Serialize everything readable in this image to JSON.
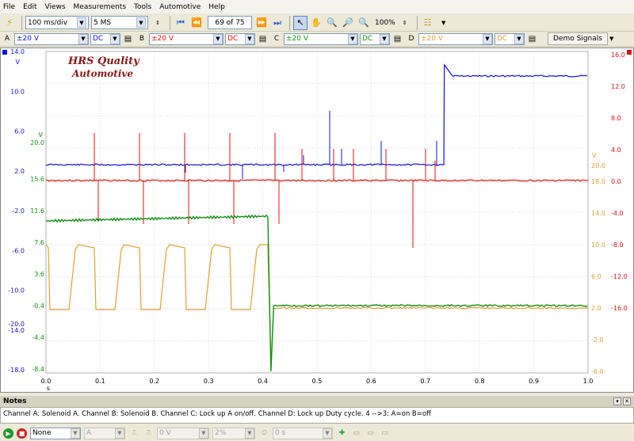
{
  "menu": [
    "File",
    "Edit",
    "Views",
    "Measurements",
    "Tools",
    "Automotive",
    "Help"
  ],
  "toolbar": {
    "timebase": "100 ms/div",
    "samples": "5 MS",
    "buffer": "69 of 75",
    "zoom": "100%"
  },
  "channels": [
    {
      "letter": "A",
      "range": "±20 V",
      "coupling": "DC",
      "color": "#1010e0"
    },
    {
      "letter": "B",
      "range": "±20 V",
      "coupling": "DC",
      "color": "#e01010"
    },
    {
      "letter": "C",
      "range": "±20 V",
      "coupling": "DC",
      "color": "#109010"
    },
    {
      "letter": "D",
      "range": "±20 V",
      "coupling": "DC",
      "color": "#e0a030"
    }
  ],
  "demo_signals": "Demo Signals",
  "watermark": {
    "line1": "HRS Quality",
    "line2": "Automotive"
  },
  "axes": {
    "A": {
      "ticks": [
        "14.0",
        "10.0",
        "6.0",
        "2.0",
        "-2.0",
        "-6.0",
        "-10.0",
        "-14.0",
        "-18.0"
      ],
      "unit": "V"
    },
    "C": {
      "ticks": [
        "20.0",
        "15.6",
        "11.6",
        "7.6",
        "3.6",
        "-0.4",
        "-4.4",
        "-8.4"
      ],
      "unit": "V"
    },
    "B": {
      "ticks": [
        "16.0",
        "12.0",
        "8.0",
        "4.0",
        "0.0",
        "-4.0",
        "-8.0",
        "-12.0",
        "-16.0"
      ]
    },
    "D": {
      "ticks": [
        "20.0",
        "18.0",
        "14.0",
        "10.0",
        "6.0",
        "2.0",
        "-2.0",
        "-6.0"
      ],
      "unit": "V"
    },
    "x_ticks": [
      "0.0",
      "0.1",
      "0.2",
      "0.3",
      "0.4",
      "0.5",
      "0.6",
      "0.7",
      "0.8",
      "0.9",
      "1.0"
    ],
    "x_unit": "s",
    "extra_left": "-20.0"
  },
  "chart_data": {
    "type": "line",
    "x_unit": "s",
    "xlim": [
      0,
      1.0
    ],
    "series": [
      {
        "name": "A",
        "color": "#1010e0",
        "x": [
          0,
          0.735,
          0.735,
          0.75,
          1.0
        ],
        "y": [
          0.0,
          0.0,
          12.6,
          11.2,
          11.2
        ]
      },
      {
        "name": "B",
        "color": "#e01010",
        "x": [
          0,
          1.0
        ],
        "y": [
          0.0,
          0.0
        ]
      },
      {
        "name": "C",
        "color": "#109010",
        "x": [
          0,
          0.41,
          0.415,
          0.42,
          1.0
        ],
        "y": [
          12.0,
          12.6,
          0.0,
          1.3,
          1.3
        ]
      },
      {
        "name": "D",
        "color": "#e0a030",
        "x": [
          0,
          0.415,
          0.42,
          1.0
        ],
        "y": [
          11.0,
          11.0,
          3.0,
          3.0
        ]
      }
    ]
  },
  "notes": {
    "title": "Notes",
    "text": "Channel A: Solenoid A.   Channel B: Solenoid B.   Channel C: Lock up A  on/off.   Channel D: Lock up Duty cycle.     4 -->3: A=on   B=off"
  },
  "statusbar": {
    "trigger_mode": "None",
    "trigger_channel": "A",
    "threshold": "0 V",
    "pretrigger": "2%",
    "delay": "0 s"
  }
}
